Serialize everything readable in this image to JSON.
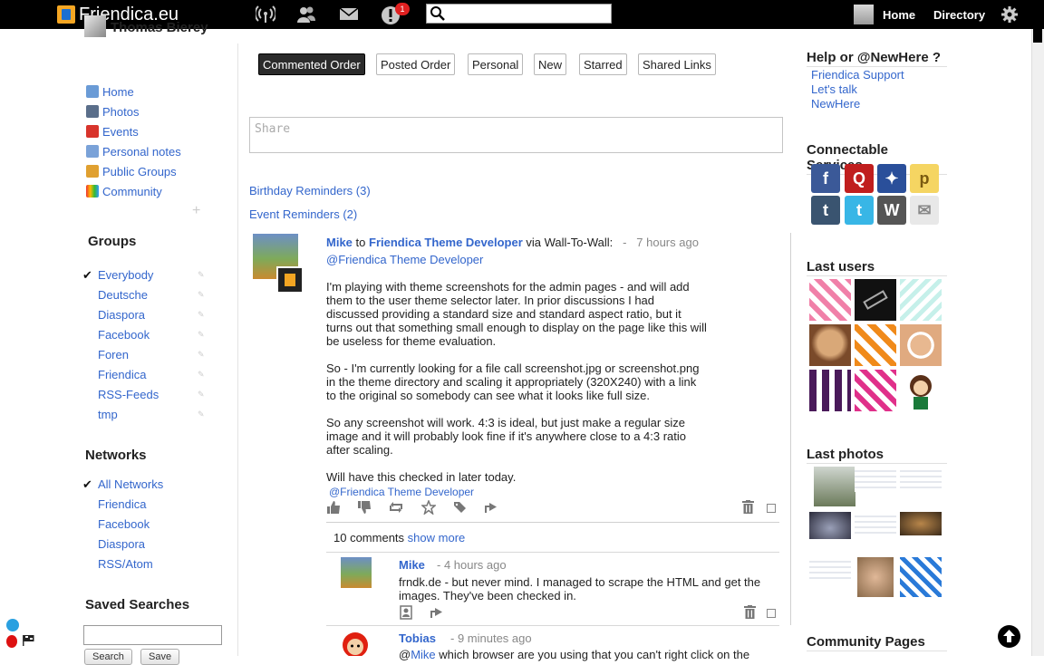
{
  "topbar": {
    "site_name": "Friendica.eu",
    "notification_count": "1",
    "search_value": "",
    "home_label": "Home",
    "directory_label": "Directory"
  },
  "aside": {
    "profile_name": "Thomas Bierey",
    "nav": [
      "Home",
      "Photos",
      "Events",
      "Personal notes",
      "Public Groups",
      "Community"
    ],
    "groups_heading": "Groups",
    "groups": [
      "Everybody",
      "Deutsche",
      "Diaspora",
      "Facebook",
      "Foren",
      "Friendica",
      "RSS-Feeds",
      "tmp"
    ],
    "groups_selected": "Everybody",
    "networks_heading": "Networks",
    "networks": [
      "All Networks",
      "Friendica",
      "Facebook",
      "Diaspora",
      "RSS/Atom"
    ],
    "networks_selected": "All Networks",
    "saved_searches_heading": "Saved Searches",
    "saved_search_value": "",
    "search_button": "Search",
    "save_button": "Save"
  },
  "tabs": [
    "Commented Order",
    "Posted Order",
    "Personal",
    "New",
    "Starred",
    "Shared Links"
  ],
  "active_tab": "Commented Order",
  "share_placeholder": "Share",
  "reminders": {
    "birthday": "Birthday Reminders (3)",
    "event": "Event Reminders (2)"
  },
  "post": {
    "author": "Mike",
    "to_word": "to",
    "recipient": "Friendica Theme Developer",
    "via": "via Wall-To-Wall:",
    "dash": "-",
    "time": "7 hours ago",
    "mention": "@Friendica Theme Developer",
    "paragraphs": [
      "I'm playing with theme screenshots for the admin pages - and will add them to the user theme selector later. In prior discussions I had discussed providing a standard size and standard aspect ratio, but it turns out that something small enough to display on the page like this will be useless for theme evaluation.",
      "So - I'm currently looking for a file call screenshot.jpg or screenshot.png in the theme directory and scaling it appropriately (320X240) with a link to the original so somebody can see what it looks like full size.",
      "So any screenshot will work. 4:3 is ideal, but just make a regular size image and it will probably look fine if it's anywhere close to a 4:3 ratio after scaling.",
      "Will have this checked in later today."
    ],
    "tag": "@Friendica Theme Developer",
    "comments_count": "10 comments",
    "show_more": "show more"
  },
  "comments": [
    {
      "author": "Mike",
      "time": "- 4 hours ago",
      "text": "frndk.de - but never mind. I managed to scrape the HTML and get the images. They've been checked in."
    },
    {
      "author": "Tobias",
      "time": "- 9 minutes ago",
      "text_prefix": "@",
      "text_link": "Mike",
      "text": " which browser are you using that you can't right click on the"
    }
  ],
  "right": {
    "help_heading": "Help or @NewHere ?",
    "help_links": [
      "Friendica Support",
      "Let's talk",
      "NewHere"
    ],
    "services_heading": "Connectable Services",
    "last_users_heading": "Last users",
    "last_photos_heading": "Last photos",
    "community_heading": "Community Pages"
  },
  "colors": {
    "link": "#3366cc",
    "topbar": "#000000",
    "badge": "#e02020"
  },
  "icons": {
    "topbar": [
      "network-icon",
      "contacts-icon",
      "messages-icon",
      "notifications-icon",
      "search-icon",
      "gear-icon"
    ],
    "post_actions": [
      "like-icon",
      "dislike-icon",
      "share-icon",
      "star-icon",
      "tag-icon",
      "reshare-icon",
      "trash-icon"
    ]
  }
}
